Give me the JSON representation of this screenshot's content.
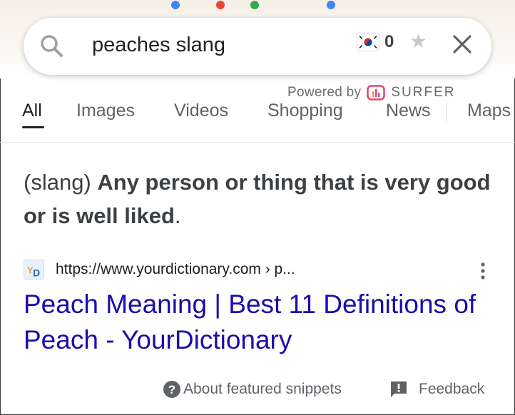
{
  "search": {
    "query": "peaches slang",
    "counter": "0"
  },
  "powered_by": {
    "prefix": "Powered by",
    "brand": "SURFER"
  },
  "tabs": [
    {
      "label": "All",
      "active": true
    },
    {
      "label": "Images"
    },
    {
      "label": "Videos"
    },
    {
      "label": "Shopping"
    },
    {
      "label": "News"
    },
    {
      "label": "Maps"
    }
  ],
  "featured_snippet": {
    "prefix": "(slang) ",
    "bold_text": "Any person or thing that is very good or is well liked",
    "suffix": ".",
    "source_url": "https://www.yourdictionary.com › p...",
    "favicon_label": "YD",
    "result_title": "Peach Meaning | Best 11 Definitions of Peach - YourDictionary"
  },
  "footer": {
    "about_label": "About featured snippets",
    "feedback_label": "Feedback"
  },
  "colors": {
    "link": "#1a0dab",
    "surfer_accent": "#e8456b",
    "doodle_blue": "#4285f4",
    "doodle_red": "#ea4335",
    "doodle_green": "#34a853"
  }
}
